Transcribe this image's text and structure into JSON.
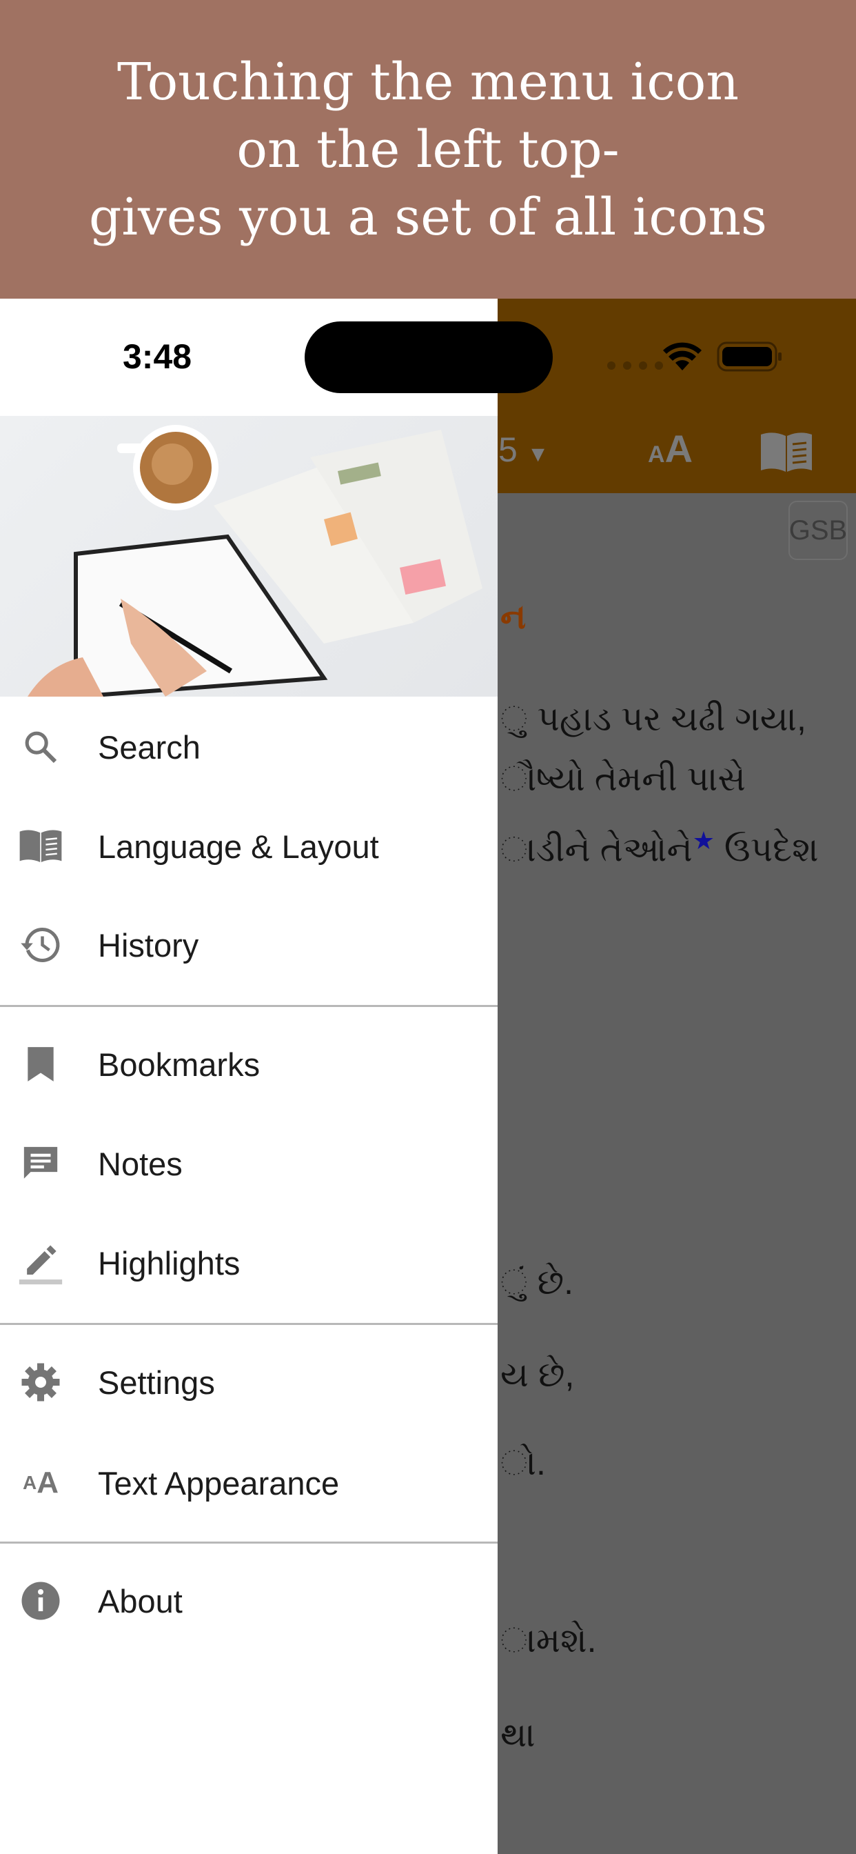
{
  "banner": {
    "lines": [
      "Touching the menu icon",
      "on the left top-",
      "gives you a set of all icons"
    ]
  },
  "status_bar": {
    "time": "3:48"
  },
  "app_bar": {
    "chapter_partial": "5",
    "chapter_caret": "▼",
    "text_size_icon": "text-size-icon",
    "book_icon": "book-open-icon"
  },
  "reader": {
    "version_badge": "GSB",
    "heading_partial": "ન",
    "verses_partial": [
      "ુ પહાડ પર ચઢી ગયા,",
      "ૌષ્યો તેમની પાસે",
      "ાડીને તેઓને",
      "ઉપદેશ",
      "ું છે.",
      "ય છે,",
      "ો.",
      "ામશે.",
      "થા"
    ],
    "star": "★"
  },
  "drawer": {
    "items": [
      {
        "label": "Search",
        "icon": "search-icon"
      },
      {
        "label": "Language & Layout",
        "icon": "book-open-icon"
      },
      {
        "label": "History",
        "icon": "history-icon"
      },
      {
        "label": "Bookmarks",
        "icon": "bookmark-icon"
      },
      {
        "label": "Notes",
        "icon": "note-icon"
      },
      {
        "label": "Highlights",
        "icon": "highlight-pen-icon"
      },
      {
        "label": "Settings",
        "icon": "gear-icon"
      },
      {
        "label": "Text Appearance",
        "icon": "text-size-icon"
      },
      {
        "label": "About",
        "icon": "info-icon"
      }
    ]
  },
  "colors": {
    "banner": "#a07262",
    "app_bar": "#633c00",
    "overlay": "#606060",
    "icon": "#757575",
    "heading": "#8a3a00",
    "star": "#10109a"
  }
}
